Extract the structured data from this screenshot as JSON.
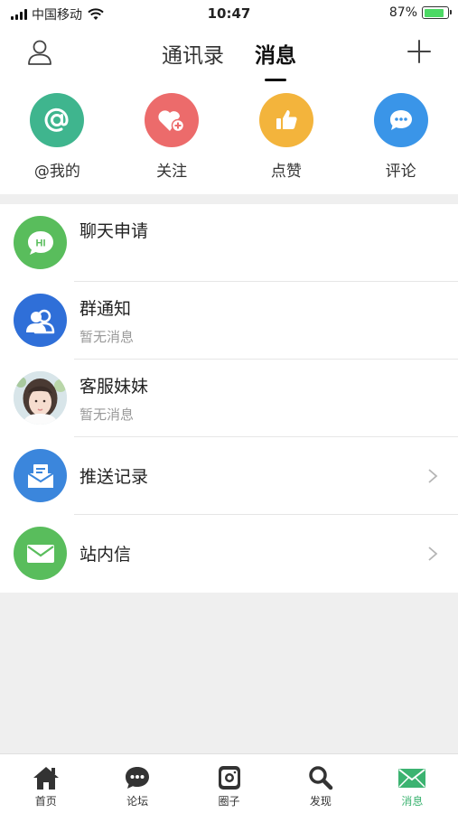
{
  "status": {
    "carrier": "中国移动",
    "time": "10:47",
    "battery": "87%"
  },
  "header": {
    "tabs": [
      "通讯录",
      "消息"
    ],
    "active_tab": 1
  },
  "quick_actions": [
    {
      "label": "@我的",
      "color": "#3fb58e",
      "icon": "at-icon"
    },
    {
      "label": "关注",
      "color": "#ec6b6b",
      "icon": "heart-plus-icon"
    },
    {
      "label": "点赞",
      "color": "#f3b43c",
      "icon": "thumbs-up-icon"
    },
    {
      "label": "评论",
      "color": "#3a95e8",
      "icon": "comment-icon"
    }
  ],
  "messages": [
    {
      "title": "聊天申请",
      "subtitle": "",
      "icon": "hi-chat-icon",
      "color": "#59bd5c"
    },
    {
      "title": "群通知",
      "subtitle": "暂无消息",
      "icon": "group-icon",
      "color": "#2f6fd8"
    },
    {
      "title": "客服妹妹",
      "subtitle": "暂无消息",
      "icon": "customer-service-avatar",
      "color": "#d9e6ef"
    },
    {
      "title": "推送记录",
      "subtitle": "",
      "icon": "push-record-icon",
      "color": "#3b86dc"
    },
    {
      "title": "站内信",
      "subtitle": "",
      "icon": "mail-icon",
      "color": "#59bd5c"
    }
  ],
  "tabbar": {
    "items": [
      {
        "label": "首页",
        "icon": "home-icon"
      },
      {
        "label": "论坛",
        "icon": "forum-icon"
      },
      {
        "label": "圈子",
        "icon": "circle-icon"
      },
      {
        "label": "发现",
        "icon": "discover-icon"
      },
      {
        "label": "消息",
        "icon": "message-icon"
      }
    ],
    "active_index": 4,
    "active_color": "#3cb371"
  }
}
